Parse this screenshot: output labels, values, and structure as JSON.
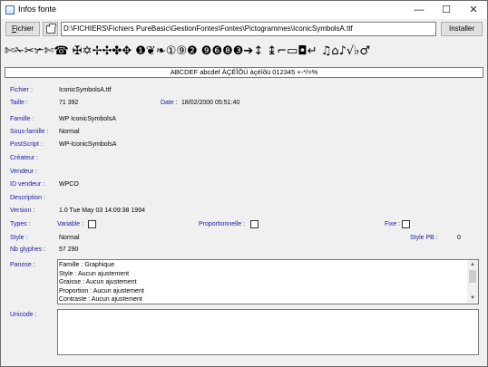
{
  "window": {
    "title": "Infos fonte",
    "minimize_glyph": "—",
    "maximize_glyph": "☐",
    "close_glyph": "✕",
    "app_icon": "font-app-icon"
  },
  "toolbar": {
    "file_button": "Fichier",
    "file_button_underline": "F",
    "file_button_rest": "ichier",
    "folder_icon": "folder-icon",
    "path": "D:\\FICHIERS\\Fichiers PureBasic\\GestionFontes\\Fontes\\Pictogrammes\\IconicSymbolsA.ttf",
    "install_button": "Installer"
  },
  "preview": {
    "symbols": "✄✁✂✃✄☎ ✠✡✢✣✤✥ ❶❦❧①⑨❷ ❾❻❽❸➔↕ ↨⌐▭◘↵ ♫⌂♪√♭♂",
    "sample_text": "ABCDEF abcdef ÀÇÉÎÕÜ àçéîõü 012345 +-*/=%"
  },
  "info": {
    "fichier_label": "Fichier :",
    "fichier_value": "IconicSymbolsA.ttf",
    "taille_label": "Taille :",
    "taille_value": "71 392",
    "date_label": "Date :",
    "date_value": "18/02/2000 05:51:40",
    "famille_label": "Famille :",
    "famille_value": "WP IconicSymbolsA",
    "sousfamille_label": "Sous-famille :",
    "sousfamille_value": "Normal",
    "postscript_label": "PostScript :",
    "postscript_value": "WP-IconicSymbolsA",
    "createur_label": "Créateur :",
    "createur_value": "",
    "vendeur_label": "Vendeur :",
    "vendeur_value": "",
    "idvendeur_label": "ID vendeur :",
    "idvendeur_value": "WPCO",
    "description_label": "Description :",
    "description_value": "",
    "version_label": "Version :",
    "version_value": "1.0 Tue May 03 14:09:38 1994",
    "types_label": "Types :",
    "variable_label": "Variable :",
    "variable_checked": false,
    "proportionnelle_label": "Proportionnelle :",
    "proportionnelle_checked": false,
    "fixe_label": "Fixe :",
    "fixe_checked": false,
    "style_label": "Style :",
    "style_value": "Normal",
    "stylepb_label": "Style PB :",
    "stylepb_value": "0",
    "nbglyphes_label": "Nb glyphes :",
    "nbglyphes_value": "57 290",
    "panose_label": "Panose :",
    "panose_lines": [
      "Famille : Graphique",
      "Style : Aucun ajustement",
      "Graisse : Aucun ajustement",
      "Proportion : Aucun ajustement",
      "Contraste : Aucun ajustement"
    ],
    "unicode_label": "Unicode :",
    "unicode_value": ""
  },
  "colors": {
    "label_blue": "#1a1aa8",
    "window_bg": "#f0f0f0"
  }
}
